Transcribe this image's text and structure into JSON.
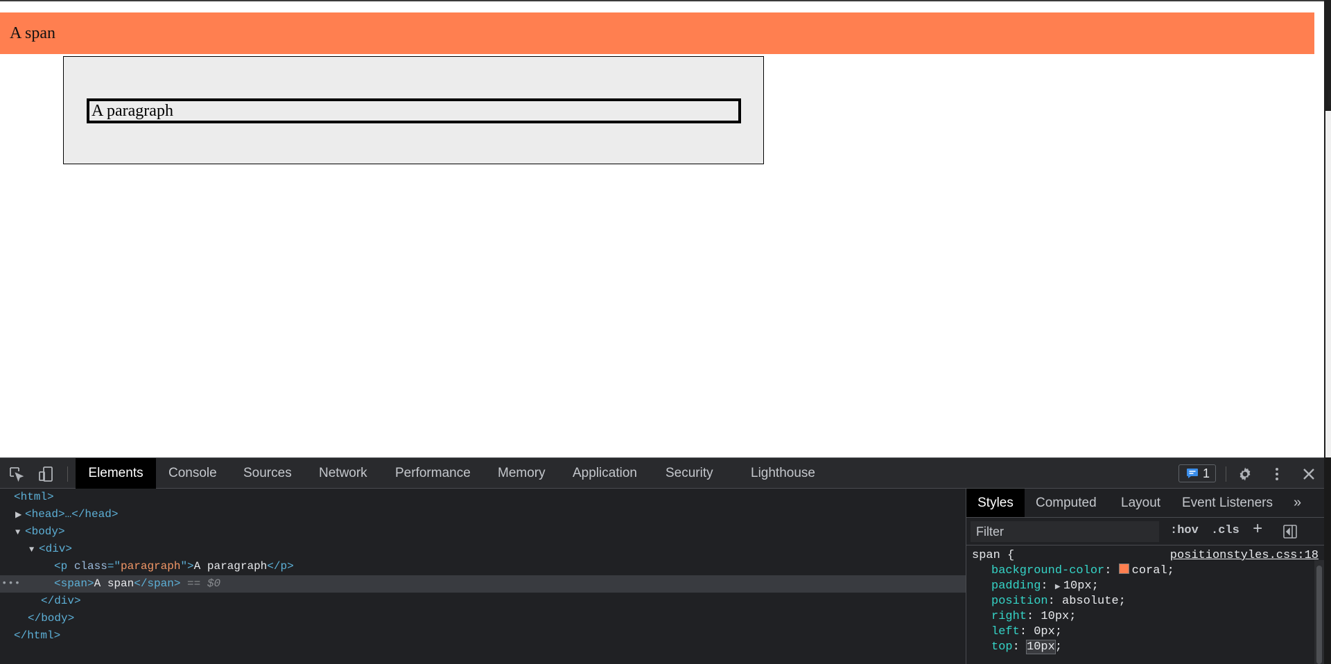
{
  "page": {
    "span_text": "A span",
    "paragraph_text": "A paragraph",
    "span_color": "#ff7f50"
  },
  "devtools": {
    "toolbar": {
      "inspect_icon": "inspect-element-icon",
      "device_icon": "device-toggle-icon",
      "tabs": [
        "Elements",
        "Console",
        "Sources",
        "Network",
        "Performance",
        "Memory",
        "Application",
        "Security",
        "Lighthouse"
      ],
      "active_tab": "Elements",
      "issues_count": "1",
      "settings_icon": "gear-icon",
      "more_icon": "more-vertical-icon",
      "close_icon": "close-icon"
    },
    "dom_tree": {
      "html_open": "<html>",
      "head": "<head>…</head>",
      "body_open": "<body>",
      "div_open": "<div>",
      "p_open_start": "<p ",
      "p_attr_name": "class",
      "p_attr_eq": "=\"",
      "p_attr_value": "paragraph",
      "p_attr_close": "\">",
      "p_text": "A paragraph",
      "p_close": "</p>",
      "span_open": "<span>",
      "span_text": "A span",
      "span_close": "</span>",
      "selected_marker": "== $0",
      "div_close": "</div>",
      "body_close": "</body>",
      "html_close": "</html>"
    },
    "styles": {
      "tabs": [
        "Styles",
        "Computed",
        "Layout",
        "Event Listeners"
      ],
      "active_tab": "Styles",
      "overflow_label": "»",
      "filter_placeholder": "Filter",
      "hov_label": ":hov",
      "cls_label": ".cls",
      "add_label": "+",
      "rule_selector": "span {",
      "rule_source": "positionstyles.css:18",
      "declarations": [
        {
          "prop": "background-color",
          "value": "coral;"
        },
        {
          "prop": "padding",
          "value": "10px;"
        },
        {
          "prop": "position",
          "value": "absolute;"
        },
        {
          "prop": "right",
          "value": "10px;"
        },
        {
          "prop": "left",
          "value": "0px;"
        },
        {
          "prop": "top",
          "value": "10px"
        }
      ],
      "semicolon": ";"
    }
  }
}
